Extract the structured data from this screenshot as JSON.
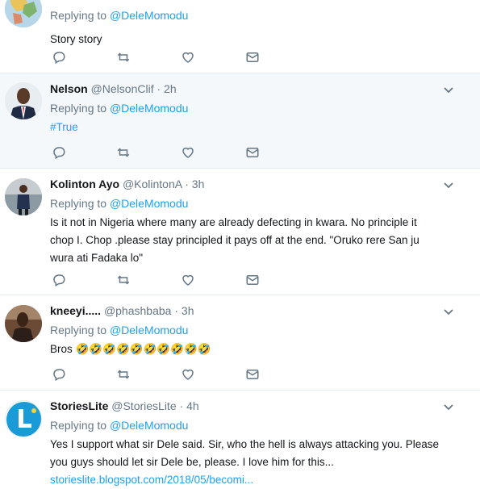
{
  "tweets": [
    {
      "name": "",
      "handle": "",
      "time": "",
      "replying_label": "Replying to",
      "mention": "@DeleMomodu",
      "text": "Story story",
      "avatar": "map-avatar"
    },
    {
      "name": "Nelson",
      "handle": "@NelsonClif",
      "dot": "·",
      "time": "2h",
      "replying_label": "Replying to",
      "mention": "@DeleMomodu",
      "hashtag": "#True",
      "avatar": "man-suit-avatar"
    },
    {
      "name": "Kolinton Ayo",
      "handle": "@KolintonA",
      "dot": "·",
      "time": "3h",
      "replying_label": "Replying to",
      "mention": "@DeleMomodu",
      "text_line1": "Is it not in Nigeria where many are already defecting in kwara. No principle it",
      "text_line2": "chop I. Chop .please stay principled it pays off at the end. \"Oruko rere San ju",
      "text_line3": "wura ati Fadaka lo\"",
      "avatar": "standing-man-avatar"
    },
    {
      "name": "kneeyi.....",
      "handle": "@phashbaba",
      "dot": "·",
      "time": "3h",
      "replying_label": "Replying to",
      "mention": "@DeleMomodu",
      "text": "Bros",
      "emoji": "🤣🤣🤣🤣🤣🤣🤣🤣🤣🤣",
      "avatar": "woman-avatar"
    },
    {
      "name": "StoriesLite",
      "handle": "@StoriesLite",
      "dot": "·",
      "time": "4h",
      "replying_label": "Replying to",
      "mention": "@DeleMomodu",
      "text_line1": "Yes I support what sir Dele said. Sir, who the hell is always attacking you. Please",
      "text_line2": "you guys should let sir Dele be, please. I love him for this...",
      "link": "storieslite.blogspot.com/2018/05/becomi...",
      "avatar": "storieslite-logo-avatar"
    }
  ],
  "icons": {
    "reply": "reply-icon",
    "retweet": "retweet-icon",
    "like": "heart-icon",
    "dm": "envelope-icon",
    "more": "chevron-down-icon"
  },
  "colors": {
    "accent": "#1da1f2",
    "secondary_text": "#657786",
    "highlight_bg": "#f5f8fa",
    "divider": "#e6ecf0"
  }
}
